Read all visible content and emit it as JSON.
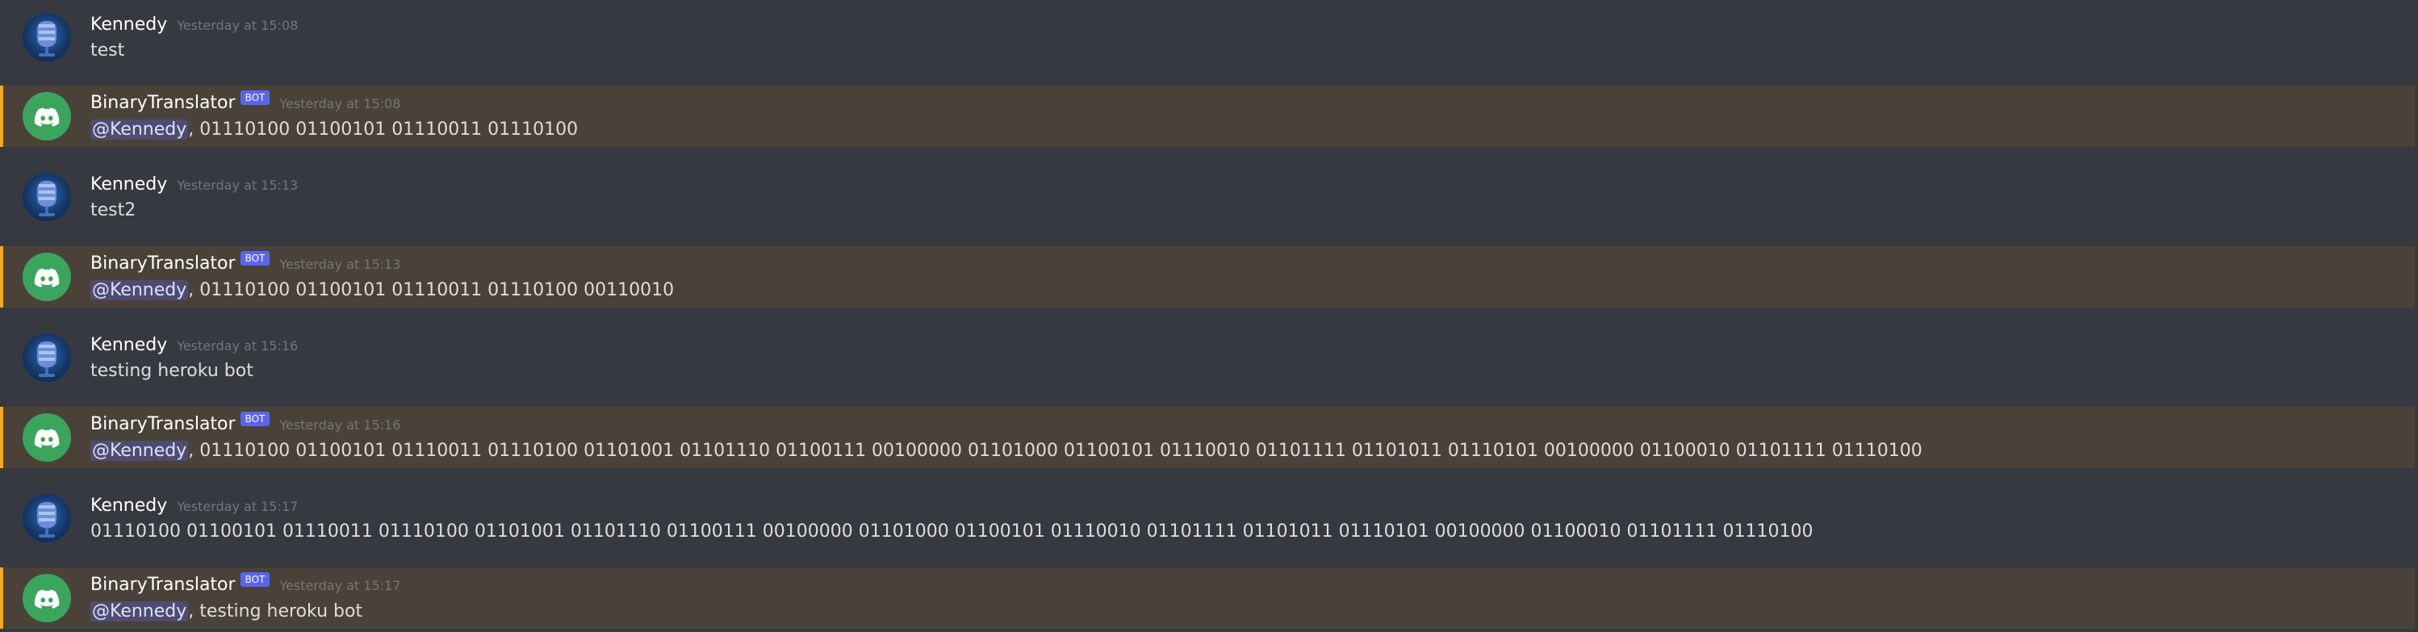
{
  "colors": {
    "background": "#36393f",
    "highlight_background": "#4a4238",
    "highlight_bar": "#faa81a",
    "bot_tag": "#5865f2",
    "bot_avatar": "#3ba55d",
    "username": "#ffffff",
    "timestamp": "#72767d",
    "message_text": "#dcddde"
  },
  "messages": [
    {
      "author": "Kennedy",
      "avatar_icon": "user-avatar-icon",
      "timestamp": "Yesterday at 15:08",
      "text": "test"
    },
    {
      "author": "BinaryTranslator",
      "is_bot": true,
      "bot_tag": "BOT",
      "avatar_icon": "discord-logo-icon",
      "timestamp": "Yesterday at 15:08",
      "mention": "@Kennedy",
      "text": ", 01110100 01100101 01110011 01110100",
      "highlighted": true
    },
    {
      "author": "Kennedy",
      "avatar_icon": "user-avatar-icon",
      "timestamp": "Yesterday at 15:13",
      "text": "test2"
    },
    {
      "author": "BinaryTranslator",
      "is_bot": true,
      "bot_tag": "BOT",
      "avatar_icon": "discord-logo-icon",
      "timestamp": "Yesterday at 15:13",
      "mention": "@Kennedy",
      "text": ", 01110100 01100101 01110011 01110100 00110010",
      "highlighted": true
    },
    {
      "author": "Kennedy",
      "avatar_icon": "user-avatar-icon",
      "timestamp": "Yesterday at 15:16",
      "text": "testing heroku bot"
    },
    {
      "author": "BinaryTranslator",
      "is_bot": true,
      "bot_tag": "BOT",
      "avatar_icon": "discord-logo-icon",
      "timestamp": "Yesterday at 15:16",
      "mention": "@Kennedy",
      "text": ", 01110100 01100101 01110011 01110100 01101001 01101110 01100111 00100000 01101000 01100101 01110010 01101111 01101011 01110101 00100000 01100010 01101111 01110100",
      "highlighted": true
    },
    {
      "author": "Kennedy",
      "avatar_icon": "user-avatar-icon",
      "timestamp": "Yesterday at 15:17",
      "text": "01110100 01100101 01110011 01110100 01101001 01101110 01100111 00100000 01101000 01100101 01110010 01101111 01101011 01110101 00100000 01100010 01101111 01110100"
    },
    {
      "author": "BinaryTranslator",
      "is_bot": true,
      "bot_tag": "BOT",
      "avatar_icon": "discord-logo-icon",
      "timestamp": "Yesterday at 15:17",
      "mention": "@Kennedy",
      "text": ", testing heroku bot",
      "highlighted": true
    }
  ]
}
